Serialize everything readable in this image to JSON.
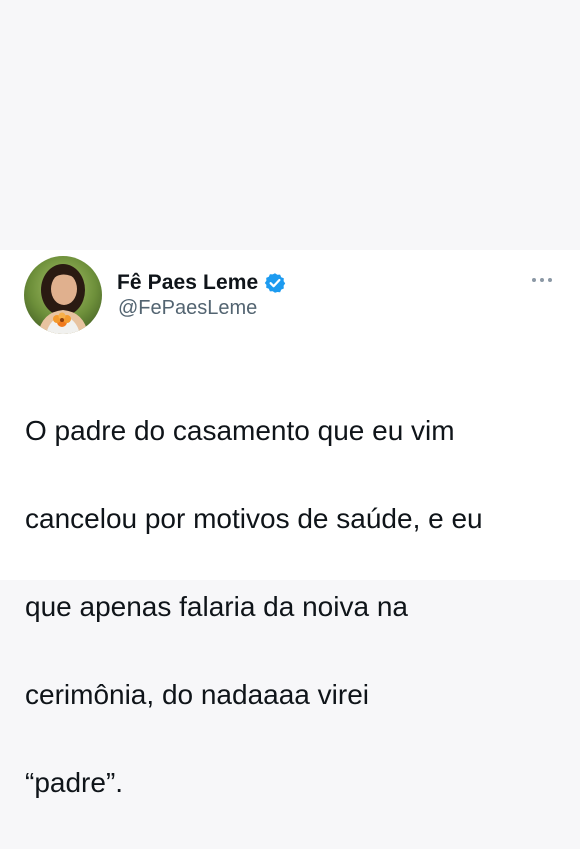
{
  "tweet": {
    "author": {
      "display_name": "Fê Paes Leme",
      "handle": "@FePaesLeme",
      "verified": true,
      "verified_badge_color": "#1d9bf0"
    },
    "more_icon": "more-options-icon",
    "text_lines": [
      "O padre do casamento que eu vim",
      "cancelou por motivos de saúde, e eu",
      "que apenas falaria da noiva na",
      "cerimônia, do nadaaaa  virei",
      "“padre”."
    ]
  },
  "colors": {
    "page_background": "#f7f7f9",
    "card_background": "#ffffff",
    "text_primary": "#0f1419",
    "text_secondary": "#536471"
  }
}
